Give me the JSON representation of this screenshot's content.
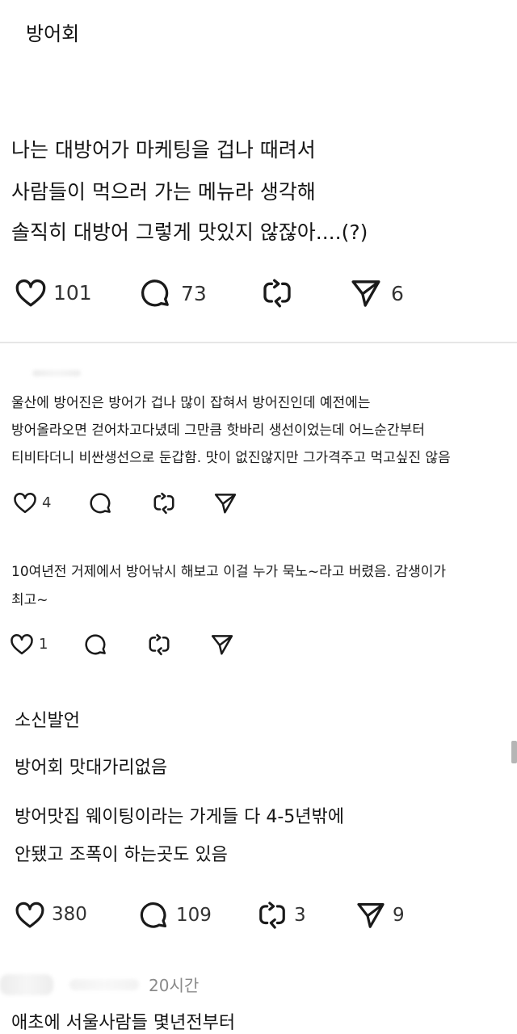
{
  "header": {
    "title": "방어회"
  },
  "post": {
    "lines": [
      "나는 대방어가 마케팅을 겁나 때려서",
      "사람들이 먹으러 가는 메뉴라 생각해",
      "솔직히 대방어 그렇게 맛있지 않잖아....(?)"
    ],
    "likes": "101",
    "comments": "73",
    "reposts": "",
    "shares": "6"
  },
  "comments": [
    {
      "lines": [
        "울산에 방어진은 방어가 겁나 많이 잡혀서 방어진인데 예전에는",
        "방어올라오면 걷어차고다녔데 그만큼 핫바리 생선이었는데 어느순간부터",
        "티비타더니 비싼생선으로 둔갑함. 맛이 없진않지만 그가격주고 먹고싶진 않음"
      ],
      "likes": "4",
      "comments": "",
      "reposts": "",
      "shares": ""
    },
    {
      "lines": [
        "10여년전 거제에서 방어낚시 해보고 이걸 누가 묵노~라고 버렸음. 감생이가",
        "최고~"
      ],
      "likes": "1",
      "comments": "",
      "reposts": "",
      "shares": ""
    },
    {
      "lines": [
        "소신발언",
        "방어회 맛대가리없음",
        "방어맛집 웨이팅이라는 가게들 다 4-5년밖에",
        "안됐고 조폭이 하는곳도 있음"
      ],
      "likes": "380",
      "comments": "109",
      "reposts": "3",
      "shares": "9"
    },
    {
      "time": "20시간",
      "lines": [
        "애초에 서울사람들 몇년전부터"
      ]
    }
  ],
  "icons": {
    "like": "heart-icon",
    "comment": "speech-bubble-icon",
    "repost": "repost-arrows-icon",
    "share": "paper-plane-icon"
  }
}
